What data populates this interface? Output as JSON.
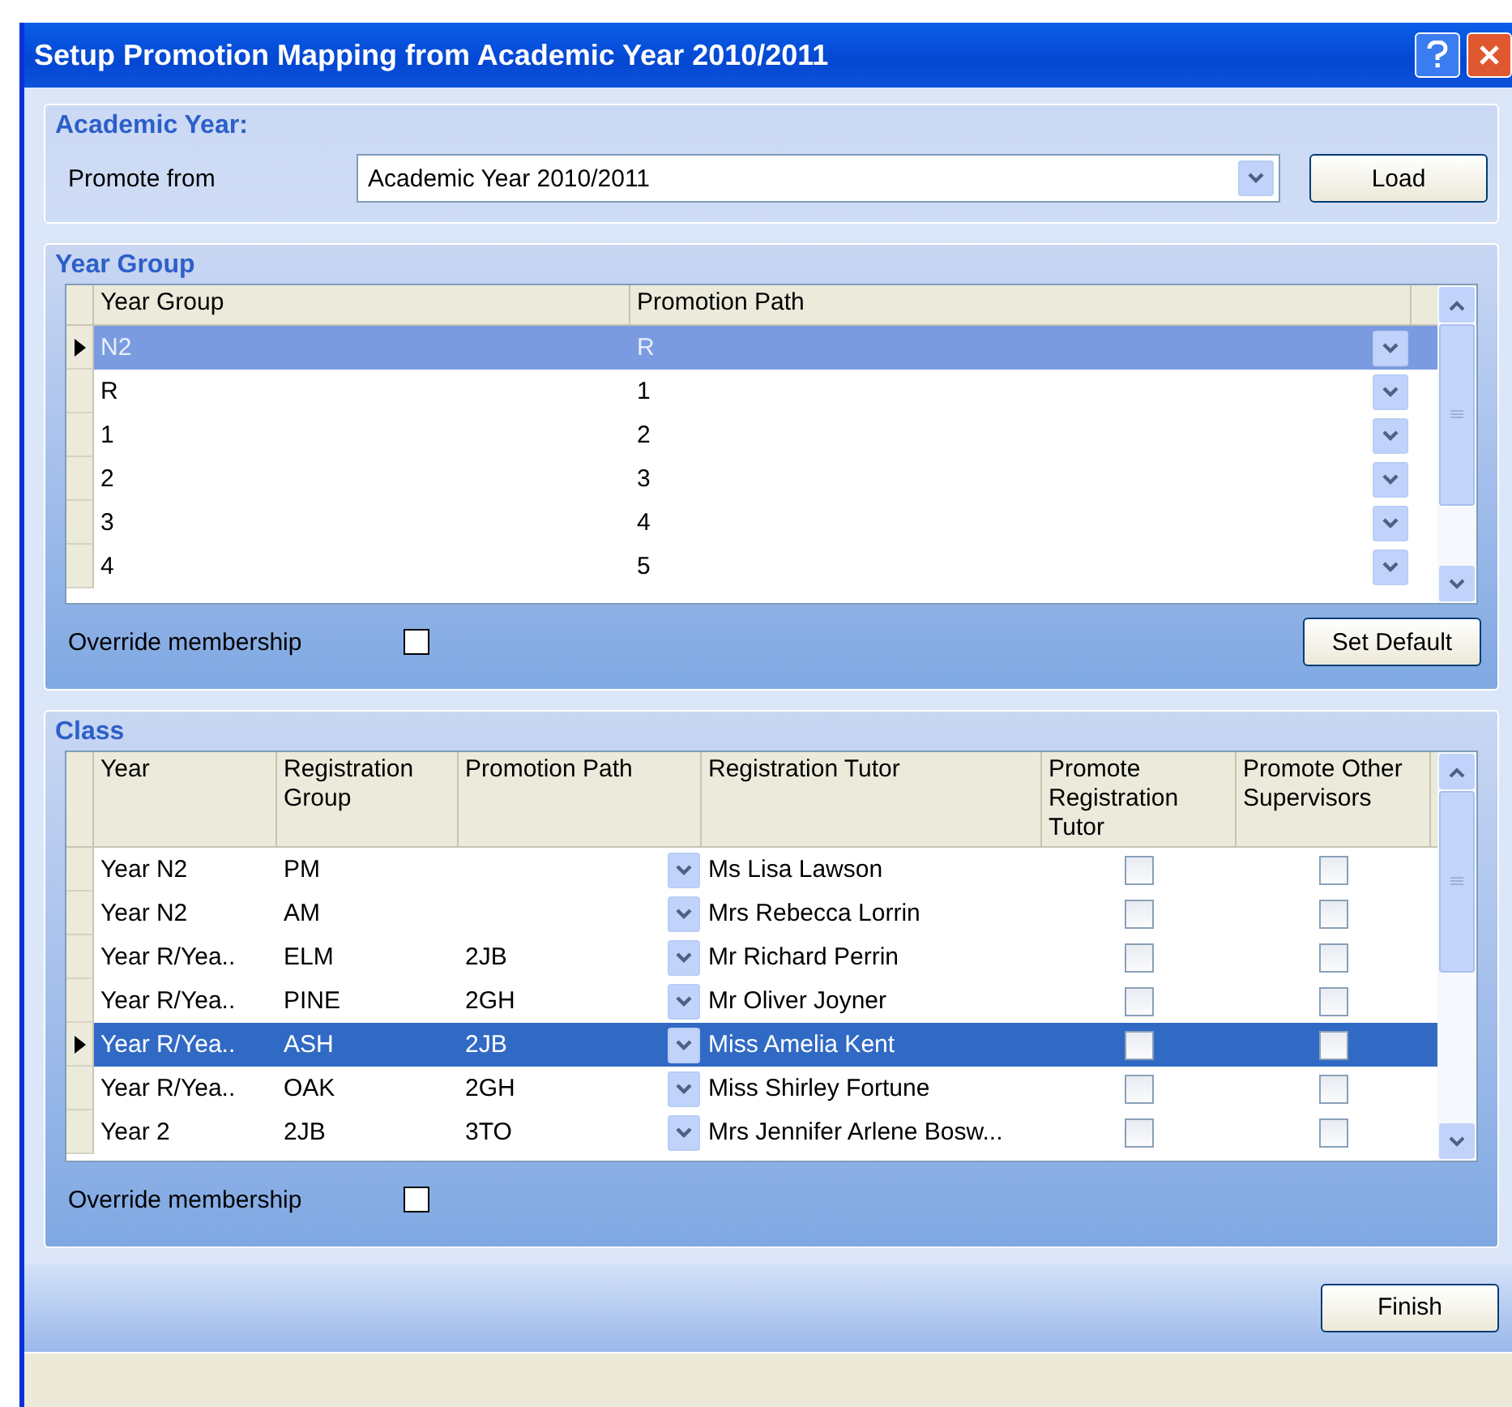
{
  "window": {
    "title": "Setup Promotion Mapping from Academic Year 2010/2011"
  },
  "academic_year": {
    "heading": "Academic Year:",
    "promote_from_label": "Promote from",
    "promote_from_value": "Academic Year 2010/2011",
    "load_button": "Load"
  },
  "year_group": {
    "heading": "Year Group",
    "columns": [
      "Year Group",
      "Promotion Path"
    ],
    "rows": [
      {
        "year_group": "N2",
        "promotion_path": "R",
        "selected": true
      },
      {
        "year_group": "R",
        "promotion_path": "1",
        "selected": false
      },
      {
        "year_group": "1",
        "promotion_path": "2",
        "selected": false
      },
      {
        "year_group": "2",
        "promotion_path": "3",
        "selected": false
      },
      {
        "year_group": "3",
        "promotion_path": "4",
        "selected": false
      },
      {
        "year_group": "4",
        "promotion_path": "5",
        "selected": false
      }
    ],
    "override_label": "Override membership",
    "override_checked": false,
    "set_default_button": "Set Default"
  },
  "class": {
    "heading": "Class",
    "columns": [
      "Year",
      "Registration Group",
      "Promotion Path",
      "Registration Tutor",
      "Promote Registration Tutor",
      "Promote Other Supervisors"
    ],
    "rows": [
      {
        "year": "Year  N2",
        "registration_group": "PM",
        "promotion_path": "",
        "registration_tutor": "Ms Lisa Lawson",
        "promote_registration_tutor": false,
        "promote_other_supervisors": false,
        "selected": false
      },
      {
        "year": "Year  N2",
        "registration_group": "AM",
        "promotion_path": "",
        "registration_tutor": "Mrs Rebecca Lorrin",
        "promote_registration_tutor": false,
        "promote_other_supervisors": false,
        "selected": false
      },
      {
        "year": "Year  R/Yea..",
        "registration_group": "ELM",
        "promotion_path": "2JB",
        "registration_tutor": "Mr Richard Perrin",
        "promote_registration_tutor": false,
        "promote_other_supervisors": false,
        "selected": false
      },
      {
        "year": "Year  R/Yea..",
        "registration_group": "PINE",
        "promotion_path": "2GH",
        "registration_tutor": "Mr Oliver Joyner",
        "promote_registration_tutor": false,
        "promote_other_supervisors": false,
        "selected": false
      },
      {
        "year": "Year  R/Yea..",
        "registration_group": "ASH",
        "promotion_path": "2JB",
        "registration_tutor": "Miss Amelia Kent",
        "promote_registration_tutor": false,
        "promote_other_supervisors": false,
        "selected": true
      },
      {
        "year": "Year  R/Yea..",
        "registration_group": "OAK",
        "promotion_path": "2GH",
        "registration_tutor": "Miss Shirley Fortune",
        "promote_registration_tutor": false,
        "promote_other_supervisors": false,
        "selected": false
      },
      {
        "year": "Year  2",
        "registration_group": "2JB",
        "promotion_path": "3TO",
        "registration_tutor": "Mrs Jennifer Arlene Bosw...",
        "promote_registration_tutor": false,
        "promote_other_supervisors": false,
        "selected": false
      }
    ],
    "override_label": "Override membership",
    "override_checked": false
  },
  "finish_button": "Finish"
}
